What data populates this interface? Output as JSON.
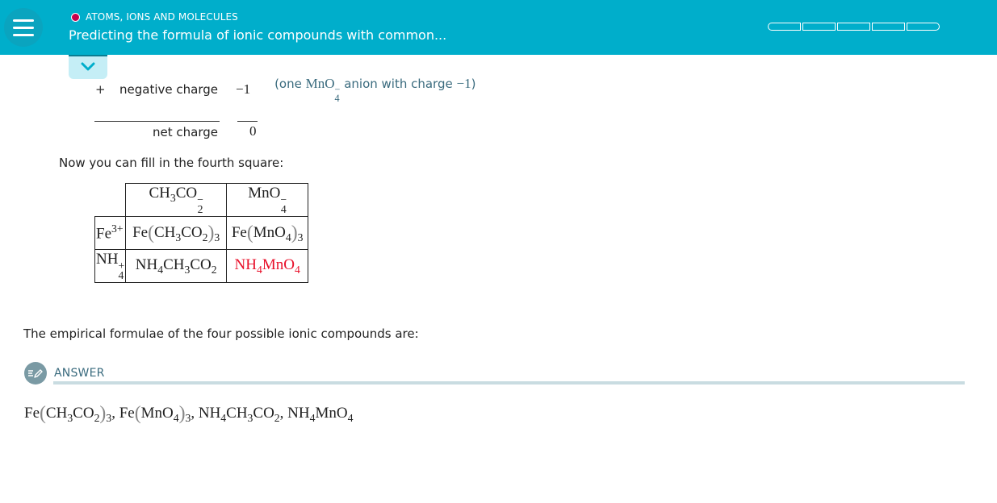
{
  "header": {
    "topic": "ATOMS, IONS AND MOLECULES",
    "title": "Predicting the formula of ionic compounds with common...",
    "menu_icon": "hamburger-menu-icon",
    "progress_segments": 5,
    "topic_dot_color": "#c6004c",
    "bar_color": "#00aecb"
  },
  "collapse_icon": "chevron-down-icon",
  "charge_table": {
    "negative_sign": "+",
    "negative_label": "negative charge",
    "negative_value": "−1",
    "note_prefix": "(one ",
    "note_ion": "MnO",
    "note_ion_sub": "4",
    "note_ion_sup": "−",
    "note_suffix": " anion with charge ",
    "note_charge": "−1",
    "note_close": ")",
    "net_label": "net charge",
    "net_value": "0"
  },
  "instruction": "Now you can fill in the fourth square:",
  "grid": {
    "col_headers": [
      {
        "base": "CH",
        "sub1": "3",
        "mid": "CO",
        "sub2": "2",
        "sup": "−"
      },
      {
        "base": "MnO",
        "sub": "4",
        "sup": "−"
      }
    ],
    "rows": [
      {
        "cation": {
          "base": "Fe",
          "sup": "3+"
        },
        "cells": [
          {
            "pre": "Fe",
            "inner_a": "CH",
            "inner_a_sub": "3",
            "inner_b": "CO",
            "inner_b_sub": "2",
            "post_sub": "3"
          },
          {
            "pre": "Fe",
            "inner_a": "MnO",
            "inner_a_sub": "4",
            "post_sub": "3"
          }
        ]
      },
      {
        "cation": {
          "base": "NH",
          "sub": "4",
          "sup": "+"
        },
        "cells": [
          {
            "a": "NH",
            "a_sub": "4",
            "b": "CH",
            "b_sub": "3",
            "c": "CO",
            "c_sub": "2"
          },
          {
            "a": "NH",
            "a_sub": "4",
            "b": "MnO",
            "b_sub": "4",
            "highlight": true
          }
        ]
      }
    ],
    "highlight_color": "#e8102a"
  },
  "summary_text": "The empirical formulae of the four possible ionic compounds are:",
  "answer": {
    "label": "ANSWER",
    "icon": "pencil-edit-icon",
    "formulas": [
      "Fe(CH3CO2)3",
      "Fe(MnO4)3",
      "NH4CH3CO2",
      "NH4MnO4"
    ],
    "separator": ", "
  }
}
